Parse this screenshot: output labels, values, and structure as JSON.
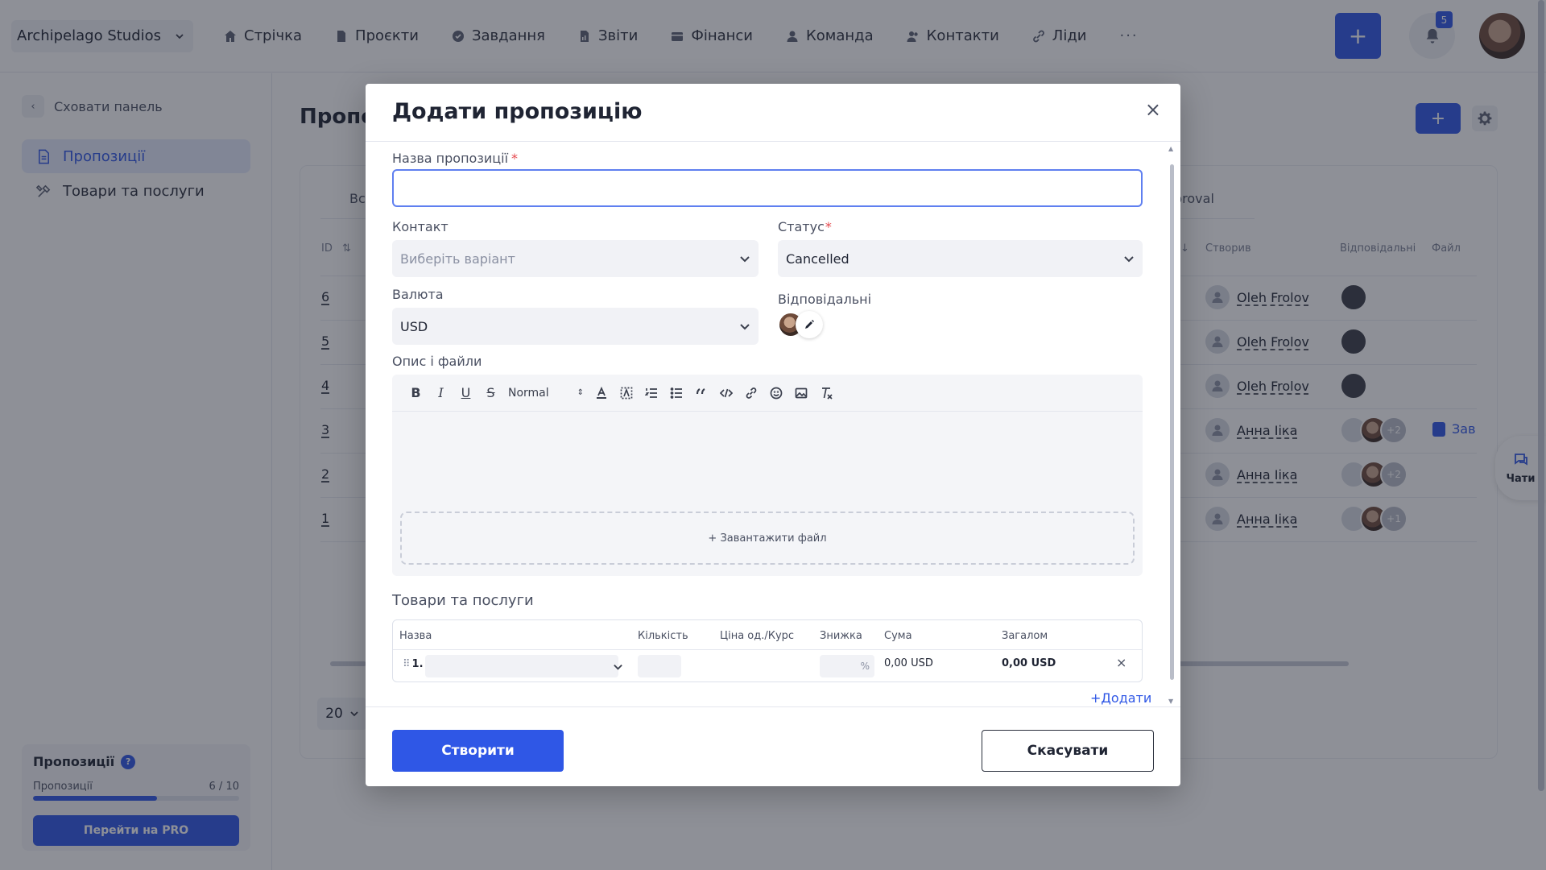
{
  "topbar": {
    "org_name": "Archipelago Studios",
    "nav": [
      {
        "label": "Стрічка",
        "icon": "home-icon"
      },
      {
        "label": "Проєкти",
        "icon": "file-icon"
      },
      {
        "label": "Завдання",
        "icon": "check-circle-icon"
      },
      {
        "label": "Звіти",
        "icon": "report-icon"
      },
      {
        "label": "Фінанси",
        "icon": "wallet-icon"
      },
      {
        "label": "Команда",
        "icon": "user-icon"
      },
      {
        "label": "Контакти",
        "icon": "contacts-icon"
      },
      {
        "label": "Ліди",
        "icon": "link-icon"
      }
    ],
    "more": "···",
    "add_label": "+",
    "notifications_count": "5"
  },
  "sidebar": {
    "hide_label": "Сховати панель",
    "items": [
      {
        "label": "Пропозиції",
        "active": true
      },
      {
        "label": "Товари та послуги",
        "active": false
      }
    ],
    "card": {
      "title": "Пропозиції",
      "help": "?",
      "row_label": "Пропозиції",
      "row_value": "6 / 10",
      "progress": 0.6,
      "cta": "Перейти на PRO"
    }
  },
  "page": {
    "title_fragment": "Пропо",
    "tab_left_fragment": "Вс",
    "tab_right_fragment": "proval",
    "col_id": "ID",
    "col_sort": "⇅",
    "col_sort_right": "↓",
    "col_creator": "Створив",
    "col_responsible": "Відповідальні",
    "col_file": "Файл",
    "rows": [
      {
        "id": "6",
        "creator": "Oleh Frolov",
        "more": ""
      },
      {
        "id": "5",
        "creator": "Oleh Frolov",
        "more": ""
      },
      {
        "id": "4",
        "creator": "Oleh Frolov",
        "more": ""
      },
      {
        "id": "3",
        "creator": "Анна Ііка",
        "more": "+2"
      },
      {
        "id": "2",
        "creator": "Анна Ііка",
        "more": "+2"
      },
      {
        "id": "1",
        "creator": "Анна Ііка",
        "more": "+1"
      }
    ],
    "file_link": "Зав",
    "per_page": "20",
    "chat_label": "Чати"
  },
  "modal": {
    "title": "Додати пропозицію",
    "close": "×",
    "name_label": "Назва пропозиції",
    "required_mark": "*",
    "name_value": "",
    "contact_label": "Контакт",
    "contact_placeholder": "Виберіть варіант",
    "status_label": "Статус",
    "status_value": "Cancelled",
    "currency_label": "Валюта",
    "currency_value": "USD",
    "responsible_label": "Відповідальні",
    "description_label": "Опис і файли",
    "toolbar": {
      "bold": "B",
      "italic": "I",
      "underline": "U",
      "strike": "S",
      "heading": "Normal"
    },
    "upload_label": "+ Завантажити файл",
    "items_title": "Товари та послуги",
    "items_headers": {
      "name": "Назва",
      "qty": "Кількість",
      "price": "Ціна од./Курс",
      "discount": "Знижка",
      "sum": "Сума",
      "total": "Загалом"
    },
    "item_row": {
      "number": "1.",
      "discount_unit": "%",
      "sum": "0,00 USD",
      "total": "0,00 USD",
      "remove": "×"
    },
    "add_item": "+Додати",
    "create": "Створити",
    "cancel": "Скасувати"
  },
  "colors": {
    "accent": "#2f57e6",
    "overlay": "#1e2230"
  }
}
